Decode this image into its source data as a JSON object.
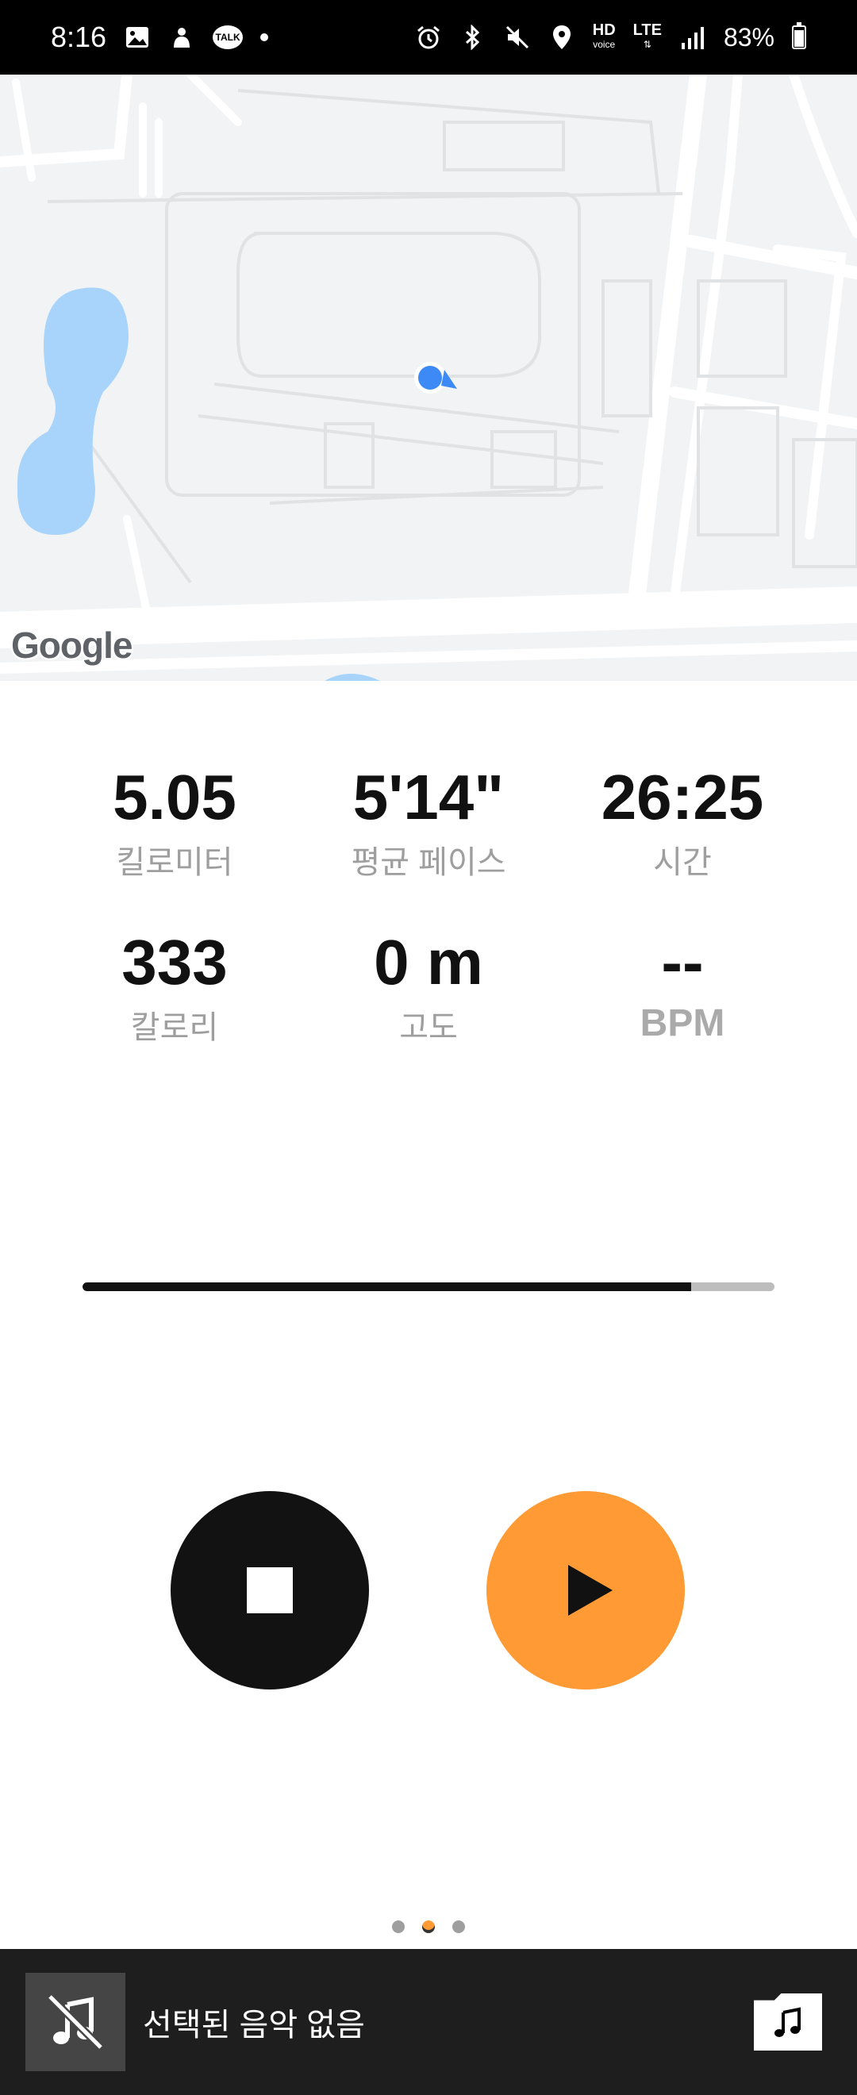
{
  "status_bar": {
    "time": "8:16",
    "talk_badge": "TALK",
    "network_hd": "HD",
    "network_voice": "voice",
    "network_lte": "LTE",
    "battery": "83%"
  },
  "map": {
    "attribution": "Google"
  },
  "stats": {
    "distance": {
      "value": "5.05",
      "label": "킬로미터"
    },
    "pace": {
      "value": "5'14\"",
      "label": "평균 페이스"
    },
    "time": {
      "value": "26:25",
      "label": "시간"
    },
    "calories": {
      "value": "333",
      "label": "칼로리"
    },
    "altitude": {
      "value": "0 m",
      "label": "고도"
    },
    "heart_rate": {
      "value": "--",
      "label": "BPM"
    }
  },
  "progress": {
    "fraction": 0.88
  },
  "controls": {
    "stop_icon": "stop-icon",
    "play_icon": "play-icon",
    "accent_color": "#ff9a35"
  },
  "pager": {
    "total": 3,
    "active_index": 1
  },
  "music": {
    "status_text": "선택된 음악 없음",
    "thumb_icon": "music-off-icon",
    "folder_icon": "music-folder-icon"
  }
}
